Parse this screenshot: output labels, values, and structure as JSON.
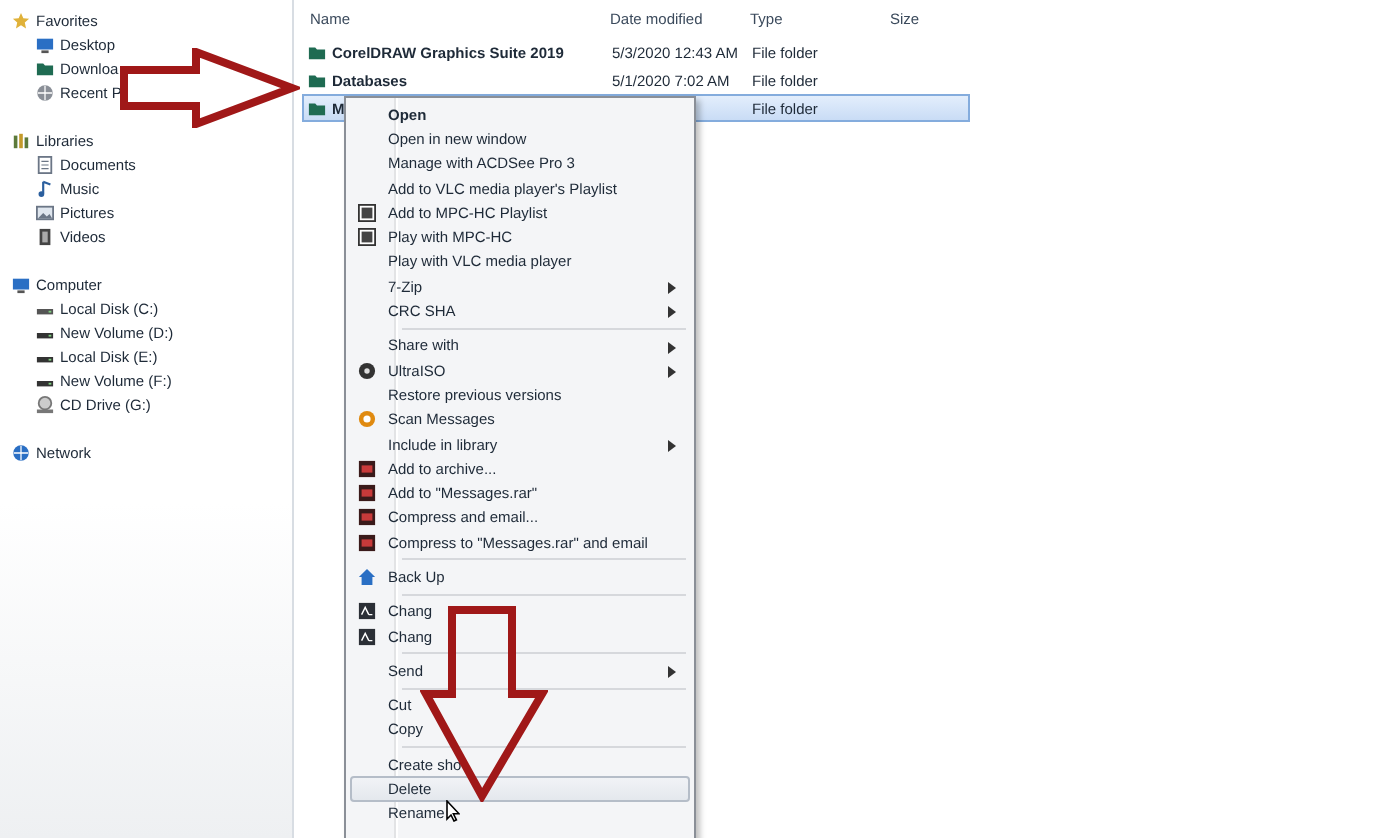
{
  "navigation": [
    {
      "label": "Favorites",
      "children": [
        {
          "label": "Desktop"
        },
        {
          "label": "Downloa"
        },
        {
          "label": "Recent P"
        }
      ]
    },
    {
      "label": "Libraries",
      "children": [
        {
          "label": "Documents"
        },
        {
          "label": "Music"
        },
        {
          "label": "Pictures"
        },
        {
          "label": "Videos"
        }
      ]
    },
    {
      "label": "Computer",
      "children": [
        {
          "label": "Local Disk (C:)"
        },
        {
          "label": "New Volume (D:)"
        },
        {
          "label": "Local Disk (E:)"
        },
        {
          "label": "New Volume (F:)"
        },
        {
          "label": "CD Drive (G:)"
        }
      ]
    },
    {
      "label": "Network"
    }
  ],
  "file_list": {
    "columns": [
      "Name",
      "Date modified",
      "Type",
      "Size"
    ],
    "rows": [
      {
        "name": "CorelDRAW Graphics Suite 2019",
        "date": "5/3/2020 12:43 AM",
        "type": "File folder",
        "selected": false
      },
      {
        "name": "Databases",
        "date": "5/1/2020 7:02 AM",
        "type": "File folder",
        "selected": false
      },
      {
        "name": "M",
        "date": "",
        "type": "File folder",
        "selected": true
      }
    ]
  },
  "context_menu": [
    {
      "kind": "item",
      "label": "Open",
      "bold": true,
      "submenu": false,
      "selected": false
    },
    {
      "kind": "item",
      "label": "Open in new window",
      "bold": false,
      "submenu": false,
      "selected": false
    },
    {
      "kind": "item",
      "label": "Manage with ACDSee Pro 3",
      "bold": false,
      "submenu": false,
      "selected": false
    },
    {
      "kind": "item",
      "label": "Add to VLC media player's Playlist",
      "bold": false,
      "submenu": false,
      "selected": false
    },
    {
      "kind": "item",
      "label": "Add to MPC-HC Playlist",
      "bold": false,
      "submenu": false,
      "selected": false
    },
    {
      "kind": "item",
      "label": "Play with MPC-HC",
      "bold": false,
      "submenu": false,
      "selected": false
    },
    {
      "kind": "item",
      "label": "Play with VLC media player",
      "bold": false,
      "submenu": false,
      "selected": false
    },
    {
      "kind": "item",
      "label": "7-Zip",
      "bold": false,
      "submenu": true,
      "selected": false
    },
    {
      "kind": "item",
      "label": "CRC SHA",
      "bold": false,
      "submenu": true,
      "selected": false
    },
    {
      "kind": "separator"
    },
    {
      "kind": "item",
      "label": "Share with",
      "bold": false,
      "submenu": true,
      "selected": false
    },
    {
      "kind": "item",
      "label": "UltraISO",
      "bold": false,
      "submenu": true,
      "selected": false
    },
    {
      "kind": "item",
      "label": "Restore previous versions",
      "bold": false,
      "submenu": false,
      "selected": false
    },
    {
      "kind": "item",
      "label": "Scan Messages",
      "bold": false,
      "submenu": false,
      "selected": false
    },
    {
      "kind": "item",
      "label": "Include in library",
      "bold": false,
      "submenu": true,
      "selected": false
    },
    {
      "kind": "item",
      "label": "Add to archive...",
      "bold": false,
      "submenu": false,
      "selected": false
    },
    {
      "kind": "item",
      "label": "Add to \"Messages.rar\"",
      "bold": false,
      "submenu": false,
      "selected": false
    },
    {
      "kind": "item",
      "label": "Compress and email...",
      "bold": false,
      "submenu": false,
      "selected": false
    },
    {
      "kind": "item",
      "label": "Compress to \"Messages.rar\" and email",
      "bold": false,
      "submenu": false,
      "selected": false
    },
    {
      "kind": "separator"
    },
    {
      "kind": "item",
      "label": "Back Up",
      "bold": false,
      "submenu": false,
      "selected": false
    },
    {
      "kind": "separator"
    },
    {
      "kind": "item",
      "label": "Chang",
      "bold": false,
      "submenu": false,
      "selected": false
    },
    {
      "kind": "item",
      "label": "Chang",
      "bold": false,
      "submenu": false,
      "selected": false
    },
    {
      "kind": "separator"
    },
    {
      "kind": "item",
      "label": "Send",
      "bold": false,
      "submenu": true,
      "selected": false
    },
    {
      "kind": "separator"
    },
    {
      "kind": "item",
      "label": "Cut",
      "bold": false,
      "submenu": false,
      "selected": false
    },
    {
      "kind": "item",
      "label": "Copy",
      "bold": false,
      "submenu": false,
      "selected": false
    },
    {
      "kind": "separator"
    },
    {
      "kind": "item",
      "label": "Create sho",
      "bold": false,
      "submenu": false,
      "selected": false
    },
    {
      "kind": "item",
      "label": "Delete",
      "bold": false,
      "submenu": false,
      "selected": true
    },
    {
      "kind": "item",
      "label": "Rename",
      "bold": false,
      "submenu": false,
      "selected": false
    }
  ]
}
